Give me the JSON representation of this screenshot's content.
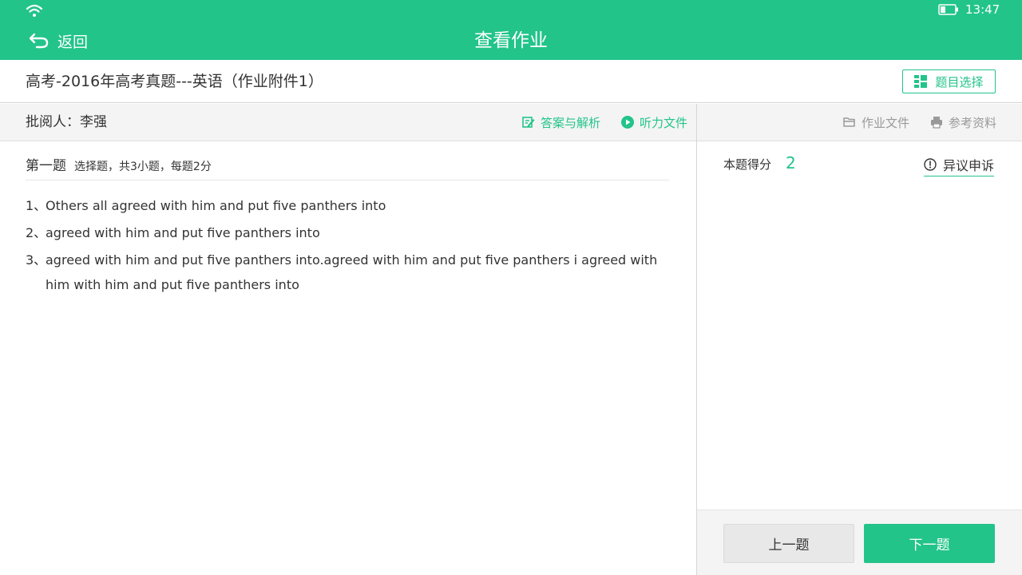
{
  "status_bar": {
    "time": "13:47",
    "wifi_icon": "wifi-icon",
    "battery_icon": "battery-icon"
  },
  "header": {
    "back_label": "返回",
    "title": "查看作业"
  },
  "homework": {
    "title": "高考-2016年高考真题---英语（作业附件1）",
    "select_button": "题目选择"
  },
  "toolbar": {
    "reviewer": "批阅人：李强",
    "answer_link": "答案与解析",
    "audio_link": "听力文件",
    "homework_file": "作业文件",
    "reference": "参考资料"
  },
  "section": {
    "number": "第一题",
    "description": "选择题，共3小题，每题2分"
  },
  "questions": [
    {
      "num": "1、",
      "text": "Others all agreed with him and put five panthers into"
    },
    {
      "num": "2、",
      "text": "agreed with him and put five panthers into"
    },
    {
      "num": "3、",
      "text": "agreed with him and put five panthers into.agreed with him and put five panthers i agreed with him with him and put five panthers into"
    }
  ],
  "score": {
    "label": "本题得分",
    "value": "2"
  },
  "appeal": {
    "label": "异议申诉"
  },
  "nav": {
    "prev": "上一题",
    "next": "下一题"
  },
  "colors": {
    "accent": "#22c48a",
    "toolbar_bg": "#f4f4f4"
  }
}
